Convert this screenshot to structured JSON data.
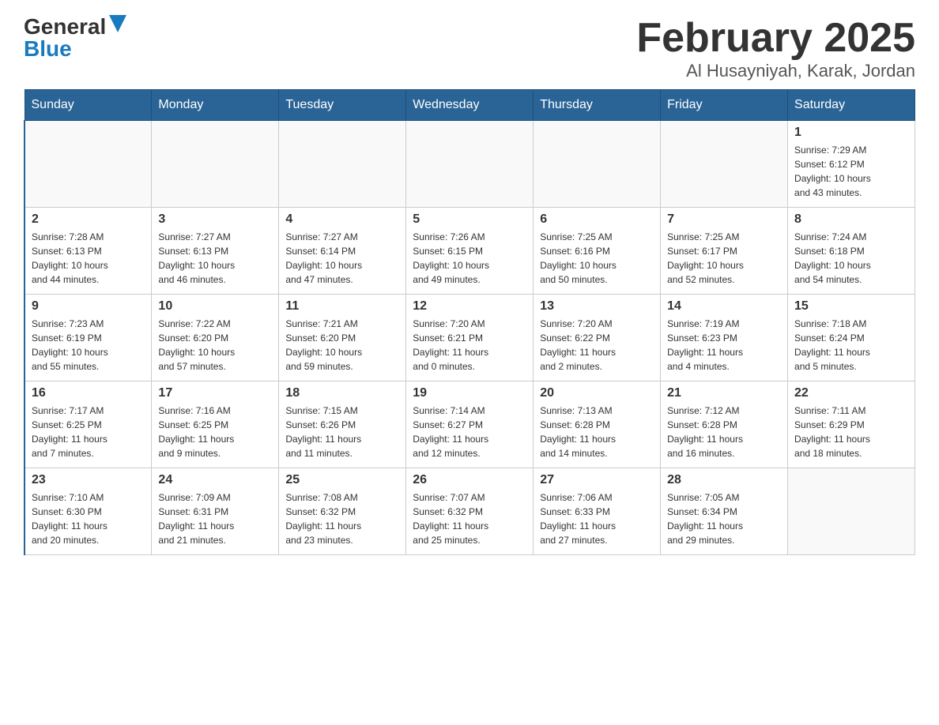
{
  "logo": {
    "general": "General",
    "blue": "Blue"
  },
  "title": "February 2025",
  "location": "Al Husayniyah, Karak, Jordan",
  "weekdays": [
    "Sunday",
    "Monday",
    "Tuesday",
    "Wednesday",
    "Thursday",
    "Friday",
    "Saturday"
  ],
  "weeks": [
    [
      {
        "day": "",
        "info": ""
      },
      {
        "day": "",
        "info": ""
      },
      {
        "day": "",
        "info": ""
      },
      {
        "day": "",
        "info": ""
      },
      {
        "day": "",
        "info": ""
      },
      {
        "day": "",
        "info": ""
      },
      {
        "day": "1",
        "info": "Sunrise: 7:29 AM\nSunset: 6:12 PM\nDaylight: 10 hours\nand 43 minutes."
      }
    ],
    [
      {
        "day": "2",
        "info": "Sunrise: 7:28 AM\nSunset: 6:13 PM\nDaylight: 10 hours\nand 44 minutes."
      },
      {
        "day": "3",
        "info": "Sunrise: 7:27 AM\nSunset: 6:13 PM\nDaylight: 10 hours\nand 46 minutes."
      },
      {
        "day": "4",
        "info": "Sunrise: 7:27 AM\nSunset: 6:14 PM\nDaylight: 10 hours\nand 47 minutes."
      },
      {
        "day": "5",
        "info": "Sunrise: 7:26 AM\nSunset: 6:15 PM\nDaylight: 10 hours\nand 49 minutes."
      },
      {
        "day": "6",
        "info": "Sunrise: 7:25 AM\nSunset: 6:16 PM\nDaylight: 10 hours\nand 50 minutes."
      },
      {
        "day": "7",
        "info": "Sunrise: 7:25 AM\nSunset: 6:17 PM\nDaylight: 10 hours\nand 52 minutes."
      },
      {
        "day": "8",
        "info": "Sunrise: 7:24 AM\nSunset: 6:18 PM\nDaylight: 10 hours\nand 54 minutes."
      }
    ],
    [
      {
        "day": "9",
        "info": "Sunrise: 7:23 AM\nSunset: 6:19 PM\nDaylight: 10 hours\nand 55 minutes."
      },
      {
        "day": "10",
        "info": "Sunrise: 7:22 AM\nSunset: 6:20 PM\nDaylight: 10 hours\nand 57 minutes."
      },
      {
        "day": "11",
        "info": "Sunrise: 7:21 AM\nSunset: 6:20 PM\nDaylight: 10 hours\nand 59 minutes."
      },
      {
        "day": "12",
        "info": "Sunrise: 7:20 AM\nSunset: 6:21 PM\nDaylight: 11 hours\nand 0 minutes."
      },
      {
        "day": "13",
        "info": "Sunrise: 7:20 AM\nSunset: 6:22 PM\nDaylight: 11 hours\nand 2 minutes."
      },
      {
        "day": "14",
        "info": "Sunrise: 7:19 AM\nSunset: 6:23 PM\nDaylight: 11 hours\nand 4 minutes."
      },
      {
        "day": "15",
        "info": "Sunrise: 7:18 AM\nSunset: 6:24 PM\nDaylight: 11 hours\nand 5 minutes."
      }
    ],
    [
      {
        "day": "16",
        "info": "Sunrise: 7:17 AM\nSunset: 6:25 PM\nDaylight: 11 hours\nand 7 minutes."
      },
      {
        "day": "17",
        "info": "Sunrise: 7:16 AM\nSunset: 6:25 PM\nDaylight: 11 hours\nand 9 minutes."
      },
      {
        "day": "18",
        "info": "Sunrise: 7:15 AM\nSunset: 6:26 PM\nDaylight: 11 hours\nand 11 minutes."
      },
      {
        "day": "19",
        "info": "Sunrise: 7:14 AM\nSunset: 6:27 PM\nDaylight: 11 hours\nand 12 minutes."
      },
      {
        "day": "20",
        "info": "Sunrise: 7:13 AM\nSunset: 6:28 PM\nDaylight: 11 hours\nand 14 minutes."
      },
      {
        "day": "21",
        "info": "Sunrise: 7:12 AM\nSunset: 6:28 PM\nDaylight: 11 hours\nand 16 minutes."
      },
      {
        "day": "22",
        "info": "Sunrise: 7:11 AM\nSunset: 6:29 PM\nDaylight: 11 hours\nand 18 minutes."
      }
    ],
    [
      {
        "day": "23",
        "info": "Sunrise: 7:10 AM\nSunset: 6:30 PM\nDaylight: 11 hours\nand 20 minutes."
      },
      {
        "day": "24",
        "info": "Sunrise: 7:09 AM\nSunset: 6:31 PM\nDaylight: 11 hours\nand 21 minutes."
      },
      {
        "day": "25",
        "info": "Sunrise: 7:08 AM\nSunset: 6:32 PM\nDaylight: 11 hours\nand 23 minutes."
      },
      {
        "day": "26",
        "info": "Sunrise: 7:07 AM\nSunset: 6:32 PM\nDaylight: 11 hours\nand 25 minutes."
      },
      {
        "day": "27",
        "info": "Sunrise: 7:06 AM\nSunset: 6:33 PM\nDaylight: 11 hours\nand 27 minutes."
      },
      {
        "day": "28",
        "info": "Sunrise: 7:05 AM\nSunset: 6:34 PM\nDaylight: 11 hours\nand 29 minutes."
      },
      {
        "day": "",
        "info": ""
      }
    ]
  ]
}
